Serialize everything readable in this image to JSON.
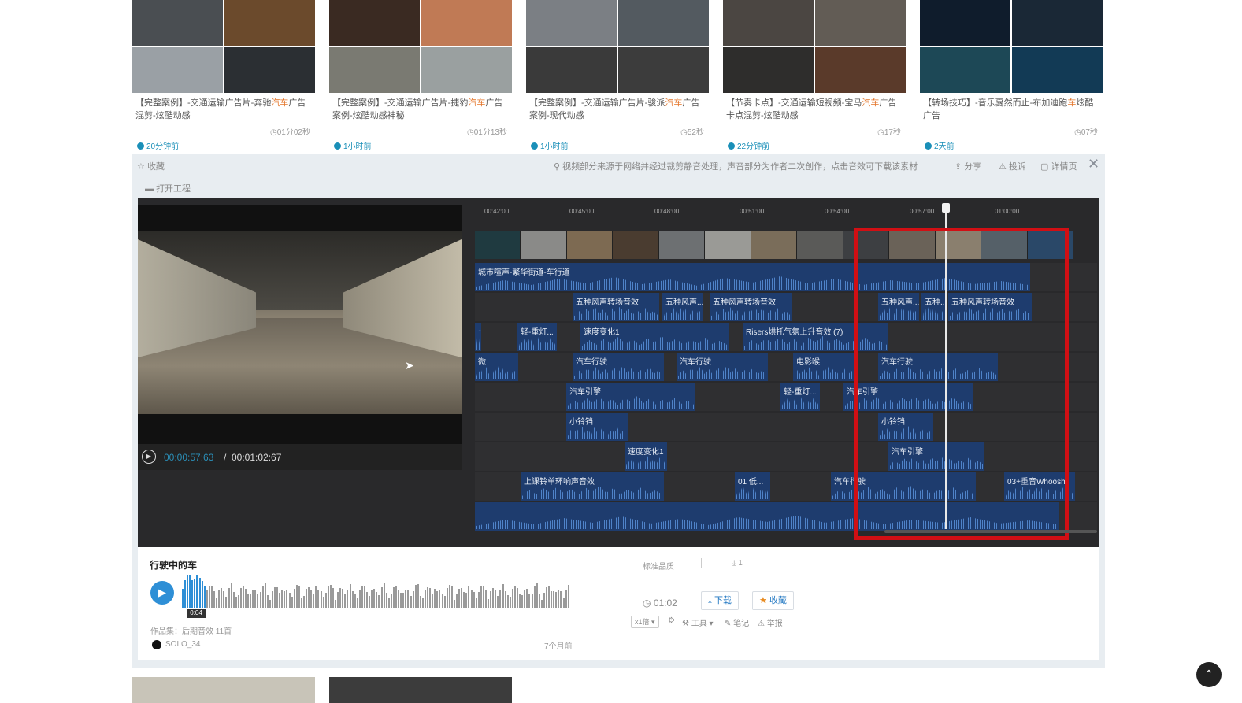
{
  "cards": [
    {
      "title_a": "【完整案例】-交通运输广告片-奔驰",
      "title_hl": "汽车",
      "title_b": "广告混剪-炫酷动感",
      "duration": "01分02秒",
      "ago": "20分钟前",
      "colors": [
        "#4a4e52",
        "#6b4a2c",
        "#9aa0a5",
        "#2b2f33"
      ]
    },
    {
      "title_a": "【完整案例】-交通运输广告片-捷豹",
      "title_hl": "汽车",
      "title_b": "广告案例-炫酷动感神秘",
      "duration": "01分13秒",
      "ago": "1小时前",
      "colors": [
        "#3a2a22",
        "#c07a55",
        "#7a7a72",
        "#9aa0a0"
      ]
    },
    {
      "title_a": "【完整案例】-交通运输广告片-骏派",
      "title_hl": "汽车",
      "title_b": "广告案例-现代动感",
      "duration": "52秒",
      "ago": "1小时前",
      "colors": [
        "#7b7f84",
        "#535a60",
        "#3a3a3a",
        "#3c3c3c"
      ]
    },
    {
      "title_a": "【节奏卡点】-交通运输短视频-宝马",
      "title_hl": "汽车",
      "title_b": "广告卡点混剪-炫酷动感",
      "duration": "17秒",
      "ago": "22分钟前",
      "colors": [
        "#4b4642",
        "#625c55",
        "#2e2d2c",
        "#5a3a2a"
      ]
    },
    {
      "title_a": "【转场技巧】-音乐戛然而止-布加迪跑",
      "title_hl": "车",
      "title_b": "炫酷广告",
      "duration": "07秒",
      "ago": "2天前",
      "colors": [
        "#0f1c2c",
        "#1a2836",
        "#1d4856",
        "#123a55"
      ]
    }
  ],
  "toolbar": {
    "favorite": "收藏",
    "notice": "视频部分来源于网络并经过裁剪静音处理，声音部分为作者二次创作，点击音效可下载该素材",
    "share": "分享",
    "report": "投诉",
    "detail": "详情页",
    "open_project": "打开工程"
  },
  "preview": {
    "current": "00:00:57:63",
    "total": "00:01:02:67"
  },
  "ruler": [
    "00:42:00",
    "00:45:00",
    "00:48:00",
    "00:51:00",
    "00:54:00",
    "00:57:00",
    "01:00:00"
  ],
  "tracks": [
    [
      {
        "label": "城市喧声-繁华街道-车行道",
        "start": 0,
        "width": 705
      }
    ],
    [
      {
        "label": "五种风声转场音效",
        "start": 124,
        "width": 110
      },
      {
        "label": "五种风声...",
        "start": 238,
        "width": 52
      },
      {
        "label": "五种风声转场音效",
        "start": 298,
        "width": 104
      },
      {
        "label": "五种风声...",
        "start": 512,
        "width": 52
      },
      {
        "label": "五种...",
        "start": 567,
        "width": 30
      },
      {
        "label": "五种风声转场音效",
        "start": 601,
        "width": 106
      }
    ],
    [
      {
        "label": "...",
        "start": 0,
        "width": 8
      },
      {
        "label": "轻-重灯...",
        "start": 54,
        "width": 50
      },
      {
        "label": "速度变化1",
        "start": 134,
        "width": 188
      },
      {
        "label": "Risers烘托气氛上升音效 (7)",
        "start": 340,
        "width": 185
      }
    ],
    [
      {
        "label": "微",
        "start": 0,
        "width": 55
      },
      {
        "label": "汽车行驶",
        "start": 124,
        "width": 116
      },
      {
        "label": "汽车行驶",
        "start": 256,
        "width": 116
      },
      {
        "label": "电影喉",
        "start": 404,
        "width": 80
      },
      {
        "label": "汽车行驶",
        "start": 512,
        "width": 152
      }
    ],
    [
      {
        "label": "汽车引擎",
        "start": 116,
        "width": 164
      },
      {
        "label": "轻-重灯...",
        "start": 388,
        "width": 50
      },
      {
        "label": "汽车引擎",
        "start": 468,
        "width": 165
      }
    ],
    [
      {
        "label": "小铃铛",
        "start": 116,
        "width": 78
      },
      {
        "label": "小铃铛",
        "start": 512,
        "width": 70
      }
    ],
    [
      {
        "label": "速度变化1",
        "start": 190,
        "width": 54
      },
      {
        "label": "汽车引擎",
        "start": 525,
        "width": 122
      }
    ],
    [
      {
        "label": "上课铃单环响声音效",
        "start": 58,
        "width": 182
      },
      {
        "label": "01 低...",
        "start": 330,
        "width": 45
      },
      {
        "label": "汽车行驶",
        "start": 452,
        "width": 184
      },
      {
        "label": "03+重音Whoosh",
        "start": 672,
        "width": 90
      }
    ],
    [
      {
        "label": "",
        "start": 0,
        "width": 742
      }
    ]
  ],
  "sound": {
    "name": "行驶中的车",
    "quality": "标准品质",
    "downloads": "1",
    "progress_label": "0:04",
    "duration": "01:02",
    "download_btn": "下载",
    "favorite_btn": "收藏",
    "speed": "x1倍",
    "tools": "工具",
    "note": "笔记",
    "report": "举报",
    "collection": "作品集：后期音效 11首",
    "author": "SOLO_34",
    "posted": "7个月前"
  }
}
